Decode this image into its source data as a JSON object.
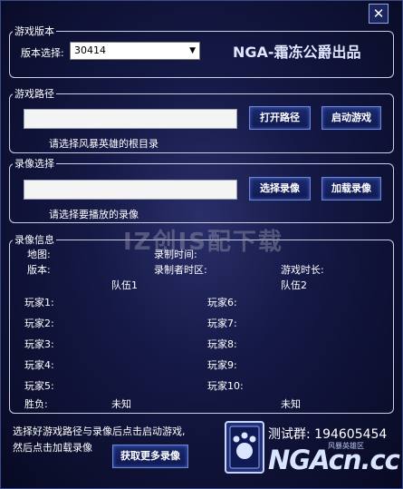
{
  "window": {
    "close_glyph": "✕"
  },
  "version_group": {
    "legend": "游戏版本",
    "select_label": "版本选择:",
    "select_value": "30414",
    "brand_text": "NGA-霜冻公爵出品"
  },
  "path_group": {
    "legend": "游戏路径",
    "input_value": "",
    "open_button": "打开路径",
    "start_button": "启动游戏",
    "hint": "请选择风暴英雄的根目录"
  },
  "replay_group": {
    "legend": "录像选择",
    "input_value": "",
    "select_button": "选择录像",
    "load_button": "加载录像",
    "hint": "请选择要播放的录像"
  },
  "info_group": {
    "legend": "录像信息",
    "map_label": "地图:",
    "record_time_label": "录制时间:",
    "version_label": "版本:",
    "timezone_label": "录制者时区:",
    "duration_label": "游戏时长:",
    "team1_label": "队伍1",
    "team2_label": "队伍2",
    "players": [
      "玩家1:",
      "玩家2:",
      "玩家3:",
      "玩家4:",
      "玩家5:",
      "玩家6:",
      "玩家7:",
      "玩家8:",
      "玩家9:",
      "玩家10:"
    ],
    "result_label": "胜负:",
    "team1_result": "未知",
    "team2_result": "未知"
  },
  "watermark": "IZ创IS配下载",
  "footer": {
    "instruction_line1": "选择好游戏路径与录像后点击启动游戏,",
    "instruction_line2": "然后点击加载录像",
    "more_button": "获取更多录像",
    "qq_group": "测试群: 194605454",
    "logo_text": "NGAcn.cc",
    "logo_sub": "风暴英雄区"
  },
  "colors": {
    "background": "#141844",
    "button_border": "#6a86d8",
    "group_border": "#c8d0e6"
  }
}
